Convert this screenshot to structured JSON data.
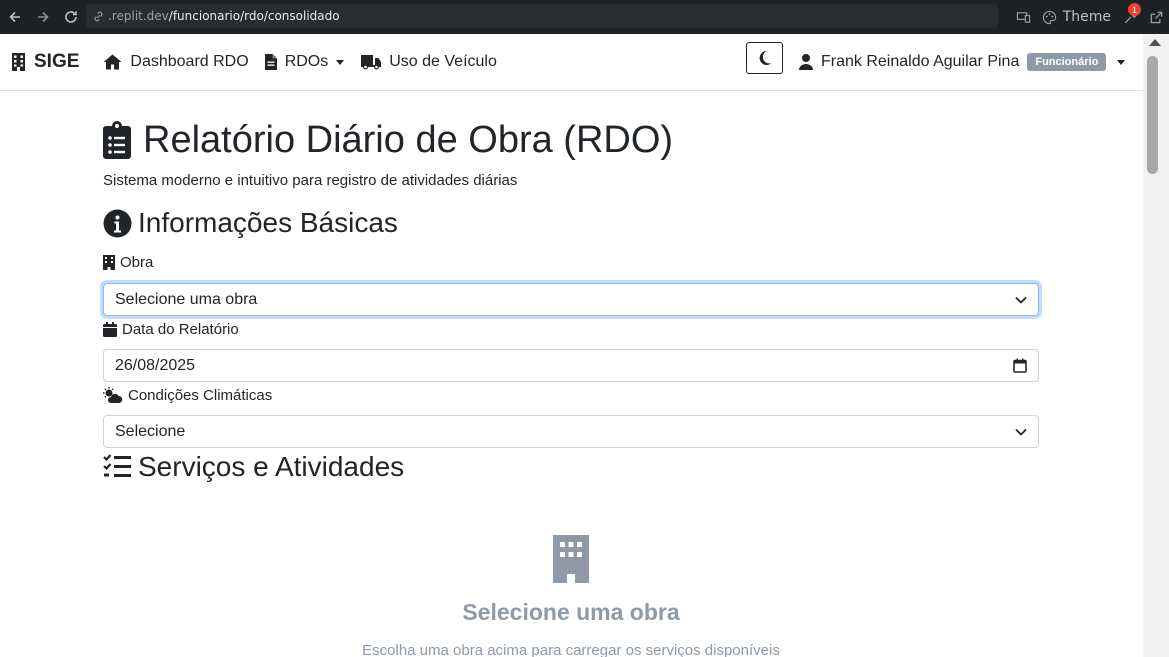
{
  "browser": {
    "url_host": ".replit.dev",
    "url_path": "/funcionario/rdo/consolidado",
    "theme_label": "Theme",
    "notification_count": "1"
  },
  "navbar": {
    "brand": "SIGE",
    "links": [
      {
        "label": "Dashboard RDO",
        "icon": "home-icon"
      },
      {
        "label": "RDOs",
        "icon": "file-icon",
        "dropdown": true
      },
      {
        "label": "Uso de Veículo",
        "icon": "truck-icon"
      }
    ],
    "user_name": "Frank Reinaldo Aguilar Pina",
    "user_role": "Funcionário"
  },
  "page": {
    "title": "Relatório Diário de Obra (RDO)",
    "subtitle": "Sistema moderno e intuitivo para registro de atividades diárias"
  },
  "basic_info": {
    "title": "Informações Básicas",
    "obra_label": "Obra",
    "obra_value": "Selecione uma obra",
    "date_label": "Data do Relatório",
    "date_value": "26/08/2025",
    "climate_label": "Condições Climáticas",
    "climate_value": "Selecione"
  },
  "services": {
    "title": "Serviços e Atividades",
    "empty_title": "Selecione uma obra",
    "empty_text": "Escolha uma obra acima para carregar os serviços disponíveis"
  },
  "colors": {
    "chrome_bg": "#202124",
    "muted": "#8f99a8",
    "focus_border": "#86b7fe"
  }
}
